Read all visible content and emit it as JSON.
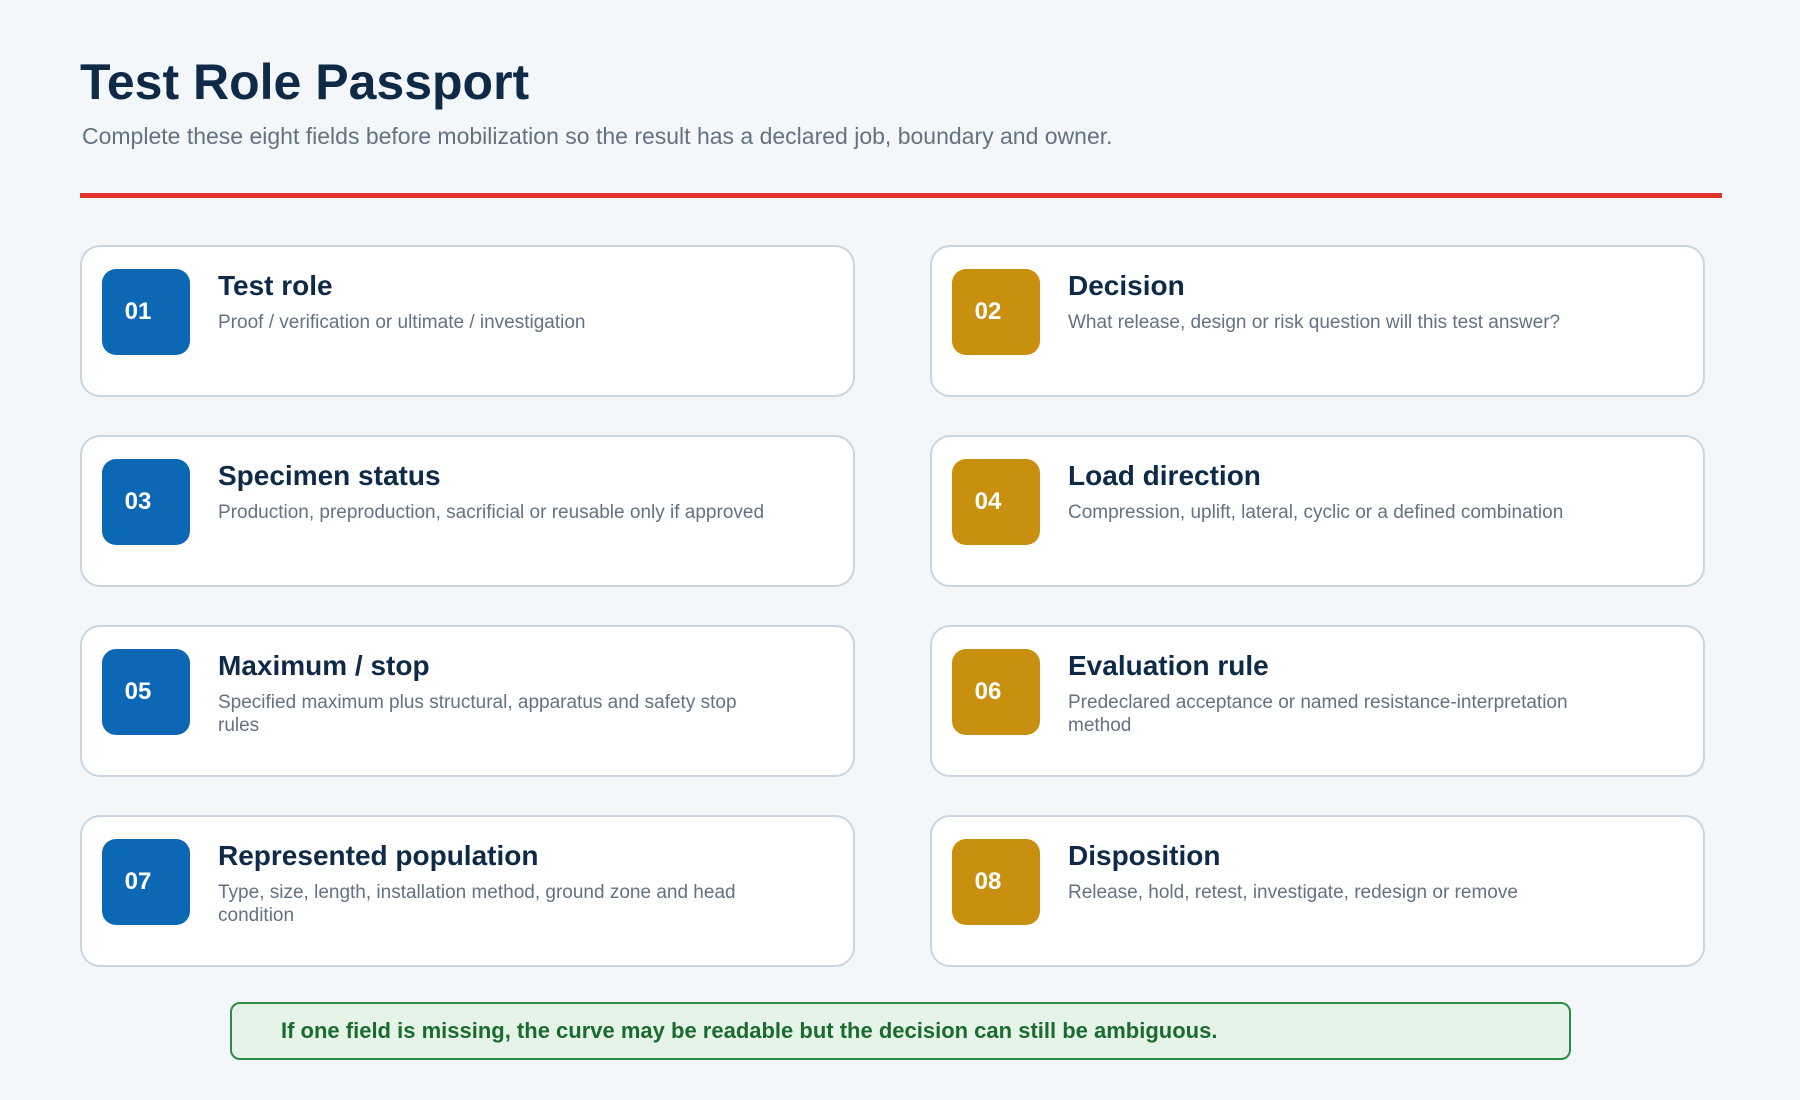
{
  "header": {
    "title": "Test Role Passport",
    "subtitle": "Complete these eight fields before mobilization so the result has a declared job, boundary and owner."
  },
  "colors": {
    "accent_rule": "#e2332d",
    "badge_blue": "#0c68b4",
    "badge_gold": "#c8900e",
    "note_border": "#2e8b46",
    "note_text": "#1a6b2f"
  },
  "fields": [
    {
      "number": "01",
      "title": "Test role",
      "description": "Proof / verification or ultimate / investigation",
      "badge_color": "blue"
    },
    {
      "number": "02",
      "title": "Decision",
      "description": "What release, design or risk question will this test answer?",
      "badge_color": "gold"
    },
    {
      "number": "03",
      "title": "Specimen status",
      "description": "Production, preproduction, sacrificial or reusable only if approved",
      "badge_color": "blue"
    },
    {
      "number": "04",
      "title": "Load direction",
      "description": "Compression, uplift, lateral, cyclic or a defined combination",
      "badge_color": "gold"
    },
    {
      "number": "05",
      "title": "Maximum / stop",
      "description": "Specified maximum plus structural, apparatus and safety stop rules",
      "badge_color": "blue"
    },
    {
      "number": "06",
      "title": "Evaluation rule",
      "description": "Predeclared acceptance or named resistance-interpretation method",
      "badge_color": "gold"
    },
    {
      "number": "07",
      "title": "Represented population",
      "description": "Type, size, length, installation method, ground zone and head condition",
      "badge_color": "blue"
    },
    {
      "number": "08",
      "title": "Disposition",
      "description": "Release, hold, retest, investigate, redesign or remove",
      "badge_color": "gold"
    }
  ],
  "note": {
    "text": "If one field is missing, the curve may be readable but the decision can still be ambiguous."
  }
}
